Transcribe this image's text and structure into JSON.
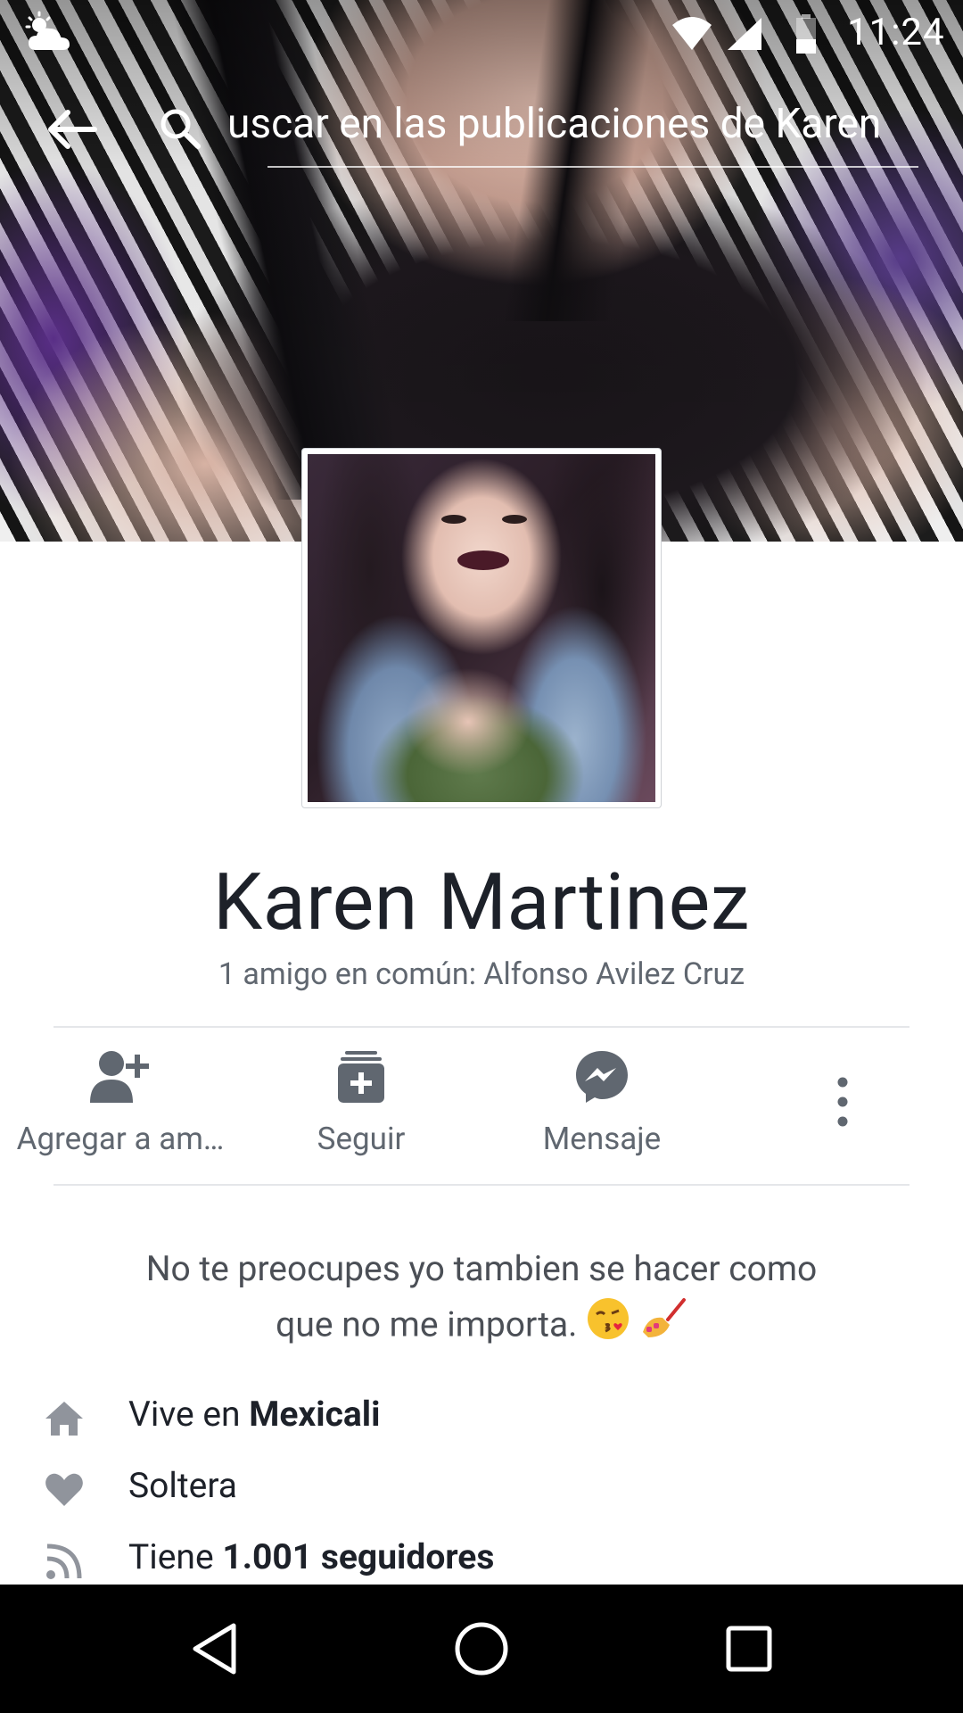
{
  "status_bar": {
    "time": "11:24",
    "icons": [
      "weather-cloudy-night-icon",
      "wifi-icon",
      "cell-signal-icon",
      "battery-icon"
    ]
  },
  "search": {
    "query_text": "uscar en las publicaciones de Karen",
    "back_icon": "arrow-left-icon",
    "search_icon": "search-icon"
  },
  "profile": {
    "name": "Karen Martinez",
    "mutual_friends": "1 amigo en común: Alfonso Avilez Cruz"
  },
  "actions": [
    {
      "label": "Agregar a am…",
      "icon": "add-friend-icon"
    },
    {
      "label": "Seguir",
      "icon": "follow-icon"
    },
    {
      "label": "Mensaje",
      "icon": "messenger-icon"
    },
    {
      "label": "",
      "icon": "more-vertical-icon"
    }
  ],
  "bio": {
    "line1": "No te preocupes yo tambien se hacer como",
    "line2": "que no me importa.",
    "emojis": [
      "kissing-face-emoji",
      "nail-polish-emoji"
    ]
  },
  "intro": {
    "lives_prefix": "Vive en ",
    "lives_city": "Mexicali",
    "relationship": "Soltera",
    "followers_prefix": "Tiene ",
    "followers_value": "1.001 seguidores"
  },
  "colors": {
    "text_primary": "#1d2129",
    "text_secondary": "#606770",
    "icon_gray": "#606770",
    "divider": "#e5e6e9",
    "nav_background": "#000000"
  },
  "nav_bar": {
    "buttons": [
      "back-triangle-icon",
      "home-circle-icon",
      "recents-square-icon"
    ]
  }
}
